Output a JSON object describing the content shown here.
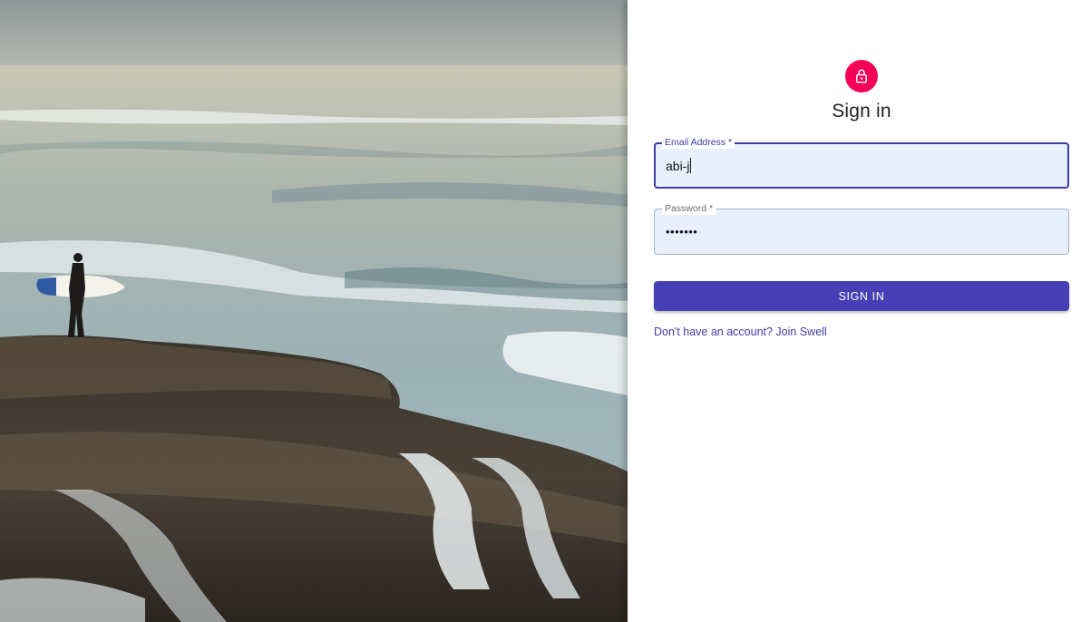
{
  "hero": {
    "alt": "Surfer holding a surfboard standing on a rocky ledge above the ocean waves"
  },
  "auth": {
    "title": "Sign in",
    "icon": "lock-icon",
    "accent_color": "#f50057",
    "primary_color": "#4740b5"
  },
  "form": {
    "email": {
      "label": "Email Address *",
      "value": "abi-j"
    },
    "password": {
      "label": "Password *",
      "value": "•••••••"
    },
    "submit_label": "SIGN IN",
    "signup_link": "Don't have an account? Join Swell"
  }
}
